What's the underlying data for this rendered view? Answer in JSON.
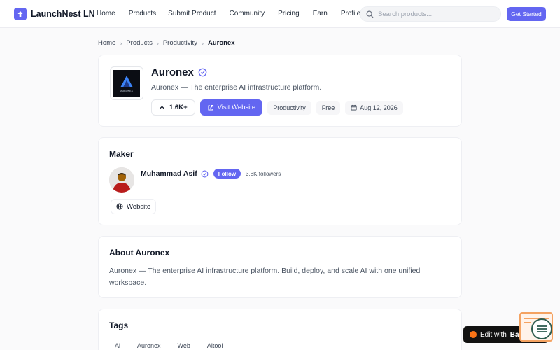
{
  "header": {
    "brand": "LaunchNest LN",
    "nav": [
      "Home",
      "Products",
      "Submit Product",
      "Community",
      "Pricing",
      "Earn",
      "Profile"
    ],
    "search_placeholder": "Search products...",
    "cta": "Get Started"
  },
  "breadcrumb": {
    "items": [
      "Home",
      "Products",
      "Productivity"
    ],
    "current": "Auronex"
  },
  "product": {
    "name": "Auronex",
    "tagline": "Auronex — The enterprise AI infrastructure platform.",
    "upvotes": "1.6K+",
    "visit_label": "Visit Website",
    "category": "Productivity",
    "pricing": "Free",
    "date": "Aug 12, 2026",
    "logo_text": "AURONEX"
  },
  "maker": {
    "title": "Maker",
    "name": "Muhammad Asif",
    "follow_label": "Follow",
    "followers": "3.8K followers",
    "website_label": "Website"
  },
  "about": {
    "title": "About Auronex",
    "text": "Auronex — The enterprise AI infrastructure platform. Build, deploy, and scale AI with one unified workspace."
  },
  "tags": {
    "title": "Tags",
    "items": [
      "Ai",
      "Auronex",
      "Web",
      "Aitool"
    ]
  },
  "widget": {
    "label_prefix": "Edit with",
    "label_brand": "Base44"
  },
  "colors": {
    "accent": "#6366f1",
    "widget_orange": "#f97316"
  }
}
